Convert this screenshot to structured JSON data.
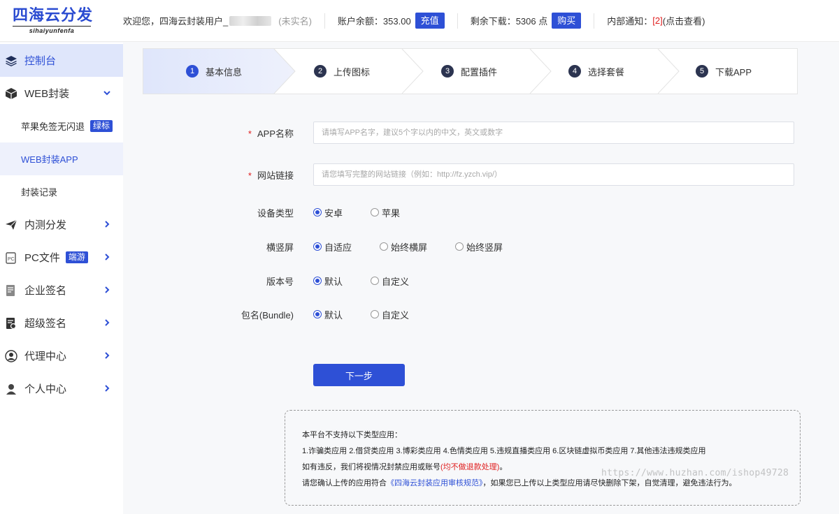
{
  "header": {
    "logo_main": "四海云分发",
    "logo_sub": "sihaiyunfenfa",
    "welcome": "欢迎您，四海云封装用户_",
    "unverified": "(未实名)",
    "balance_label": "账户余额：353.00",
    "recharge_btn": "充值",
    "downloads_label": "剩余下载：5306 点",
    "buy_btn": "购买",
    "notice_label": "内部通知：",
    "notice_count": "[2]",
    "notice_action": "(点击查看)"
  },
  "sidebar": {
    "items": [
      {
        "label": "控制台",
        "icon": "layers-icon"
      },
      {
        "label": "WEB封装",
        "icon": "box-icon"
      },
      {
        "label": "苹果免签无闪退",
        "tag": "绿标"
      },
      {
        "label": "WEB封装APP"
      },
      {
        "label": "封装记录"
      },
      {
        "label": "内测分发",
        "icon": "paper-plane-icon"
      },
      {
        "label": "PC文件",
        "tag": "端游",
        "icon": "pc-file-icon"
      },
      {
        "label": "企业签名",
        "icon": "document-sign-icon"
      },
      {
        "label": "超级签名",
        "icon": "certificate-icon"
      },
      {
        "label": "代理中心",
        "icon": "agent-icon"
      },
      {
        "label": "个人中心",
        "icon": "user-icon"
      }
    ]
  },
  "steps": [
    {
      "num": "1",
      "label": "基本信息"
    },
    {
      "num": "2",
      "label": "上传图标"
    },
    {
      "num": "3",
      "label": "配置插件"
    },
    {
      "num": "4",
      "label": "选择套餐"
    },
    {
      "num": "5",
      "label": "下载APP"
    }
  ],
  "form": {
    "app_name_label": "APP名称",
    "app_name_placeholder": "请填写APP名字，建议5个字以内的中文，英文或数字",
    "site_link_label": "网站链接",
    "site_link_placeholder": "请您填写完整的网站链接（例如：http://fz.yzch.vip/）",
    "device_label": "设备类型",
    "device_options": [
      "安卓",
      "苹果"
    ],
    "orientation_label": "横竖屏",
    "orientation_options": [
      "自适应",
      "始终横屏",
      "始终竖屏"
    ],
    "version_label": "版本号",
    "version_options": [
      "默认",
      "自定义"
    ],
    "bundle_label": "包名(Bundle)",
    "bundle_options": [
      "默认",
      "自定义"
    ],
    "next_btn": "下一步"
  },
  "notice": {
    "line1": "本平台不支持以下类型应用：",
    "line2": "1.诈骗类应用 2.借贷类应用 3.博彩类应用 4.色情类应用 5.违规直播类应用 6.区块链虚拟币类应用 7.其他违法违规类应用",
    "line3_pre": "如有违反，我们将视情况封禁应用或账号",
    "line3_red": "(均不做退款处理)",
    "line3_post": "。",
    "line4_pre": "请您确认上传的应用符合",
    "line4_link": "《四海云封装应用审核规范》",
    "line4_post": "，如果您已上传以上类型应用请尽快删除下架，自觉清理，避免违法行为。"
  },
  "watermark": "https://www.huzhan.com/ishop49728",
  "colors": {
    "accent": "#2e50d6",
    "danger": "#e02020"
  }
}
